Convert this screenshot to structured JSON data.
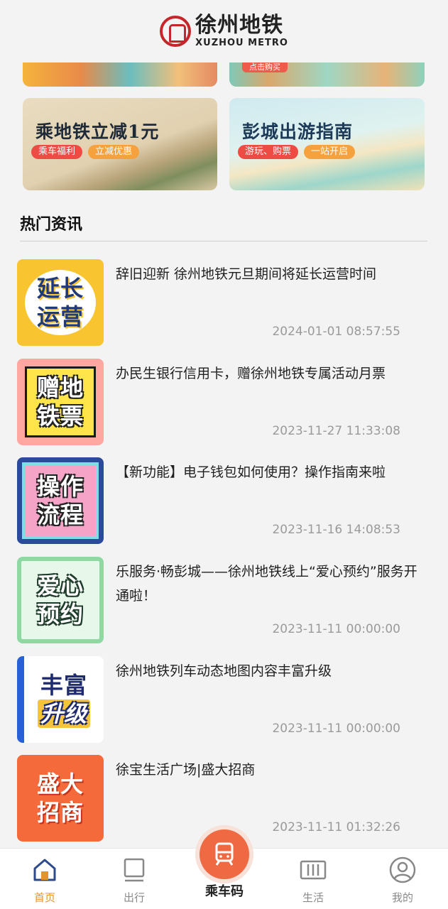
{
  "header": {
    "logo_cn": "徐州地铁",
    "logo_en": "XUZHOU METRO"
  },
  "top_banners": [
    {
      "badge": ""
    },
    {
      "badge": "点击购买"
    }
  ],
  "promo_cards": [
    {
      "title": "乘地铁立减1元",
      "tags": [
        "乘车福利",
        "立减优惠"
      ]
    },
    {
      "title": "彭城出游指南",
      "tags": [
        "游玩、购票",
        "一站开启"
      ]
    }
  ],
  "section": {
    "title": "热门资讯"
  },
  "news": [
    {
      "thumb": [
        "延长",
        "运营"
      ],
      "title": "辞旧迎新 徐州地铁元旦期间将延长运营时间",
      "time": "2024-01-01 08:57:55"
    },
    {
      "thumb": [
        "赠地",
        "铁票"
      ],
      "title": "办民生银行信用卡，赠徐州地铁专属活动月票",
      "time": "2023-11-27 11:33:08"
    },
    {
      "thumb": [
        "操作",
        "流程"
      ],
      "title": "【新功能】电子钱包如何使用？操作指南来啦",
      "time": "2023-11-16 14:08:53"
    },
    {
      "thumb": [
        "爱心",
        "预约"
      ],
      "title": "乐服务·畅彭城——徐州地铁线上“爱心预约”服务开通啦！",
      "time": "2023-11-11 00:00:00"
    },
    {
      "thumb": [
        "丰富",
        "升级"
      ],
      "title": "徐州地铁列车动态地图内容丰富升级",
      "time": "2023-11-11 00:00:00"
    },
    {
      "thumb": [
        "盛大",
        "招商"
      ],
      "title": "徐宝生活广场|盛大招商",
      "time": "2023-11-11 01:32:26"
    }
  ],
  "tabbar": {
    "home": "首页",
    "travel": "出行",
    "ride_code": "乘车码",
    "life": "生活",
    "mine": "我的"
  },
  "colors": {
    "accent": "#e4952a",
    "brand_red": "#c4262b",
    "center_button": "#ef6a43"
  }
}
